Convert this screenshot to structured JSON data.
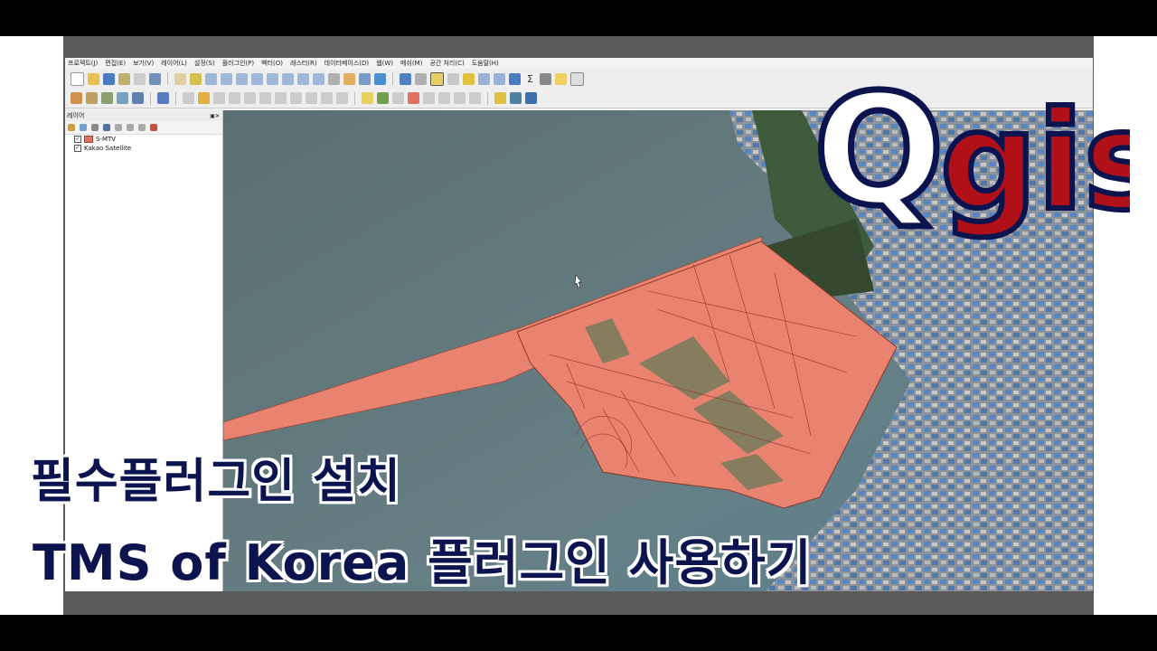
{
  "menu": [
    "프로젝트(J)",
    "편집(E)",
    "보기(V)",
    "레이어(L)",
    "설정(S)",
    "플러그인(P)",
    "벡터(O)",
    "래스터(R)",
    "데이터베이스(D)",
    "웹(W)",
    "메쉬(M)",
    "공간 처리(C)",
    "도움말(H)"
  ],
  "layers_panel": {
    "title": "레이어",
    "items": [
      {
        "name": "S-MTV",
        "checked": true,
        "color": "#e07060"
      },
      {
        "name": "Kakao Satellite",
        "checked": true
      }
    ]
  },
  "caption": {
    "line1": "필수플러그인 설치",
    "line2": "TMS of Korea 플러그인 사용하기"
  },
  "logo": {
    "text": "Qgis"
  },
  "colors": {
    "caption": "#0c1450",
    "logo_red": "#b01018",
    "logo_outline": "#0c1450",
    "parcel": "#e9826f",
    "water": "#5f7a80"
  }
}
